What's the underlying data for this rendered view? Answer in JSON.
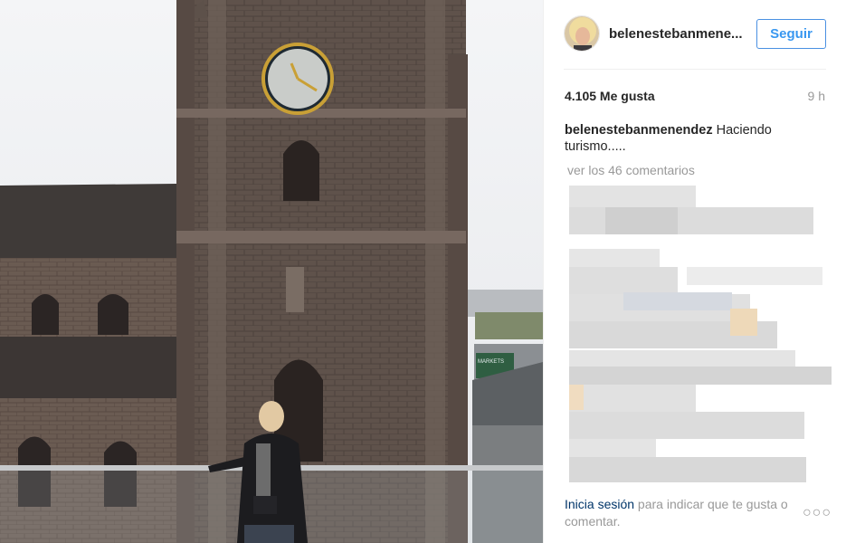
{
  "post": {
    "username": "belenestebanmenendez",
    "username_display": "belenestebanmene...",
    "follow_label": "Seguir",
    "likes": "4.105 Me gusta",
    "time_ago": "9 h",
    "caption_user": "belenestebanmenendez",
    "caption_text": " Haciendo turismo.....",
    "view_comments": "ver los 46 comentarios",
    "footer_login": "Inicia sesión",
    "footer_text": " para indicar que te gusta o comentar.",
    "more_label": "○○○"
  },
  "photo": {
    "sign_text": "MARKETS"
  },
  "colors": {
    "link_blue": "#3897f0",
    "muted_grey": "#999999",
    "login_navy": "#003569"
  },
  "icons": [
    "more-options-icon"
  ]
}
